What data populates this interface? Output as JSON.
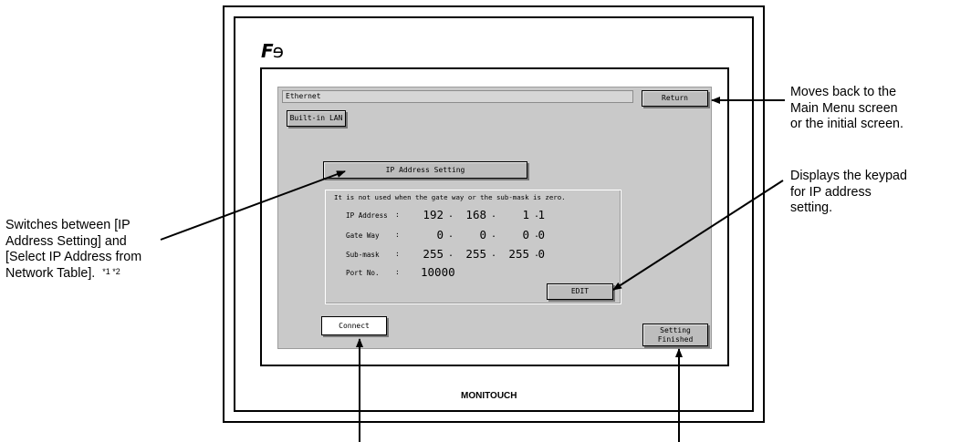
{
  "device": {
    "brand": "MONITOUCH",
    "logo": "FE"
  },
  "screen": {
    "title": "Ethernet",
    "return_label": "Return",
    "tab_label": "Built-in LAN",
    "mode_button_label": "IP Address Setting",
    "note": "It is not used when the gate way or the sub-mask is zero.",
    "fields": [
      {
        "label": "IP Address",
        "colon": ":",
        "octets": [
          "192",
          "168",
          "1",
          "1"
        ]
      },
      {
        "label": "Gate Way",
        "colon": ":",
        "octets": [
          "0",
          "0",
          "0",
          "0"
        ]
      },
      {
        "label": "Sub-mask",
        "colon": ":",
        "octets": [
          "255",
          "255",
          "255",
          "0"
        ]
      },
      {
        "label": "Port No.",
        "colon": ":",
        "value": "10000"
      }
    ],
    "edit_label": "EDIT",
    "connect_label": "Connect",
    "finished_label_1": "Setting",
    "finished_label_2": "Finished"
  },
  "annotations": {
    "return": [
      "Moves back to the",
      "Main Menu screen",
      "or the initial screen."
    ],
    "edit": [
      "Displays the keypad",
      "for IP address",
      "setting."
    ],
    "mode": [
      "Switches between [IP",
      "Address Setting] and",
      "[Select IP Address from",
      "Network Table]."
    ],
    "mode_footnote": "*1 *2"
  }
}
